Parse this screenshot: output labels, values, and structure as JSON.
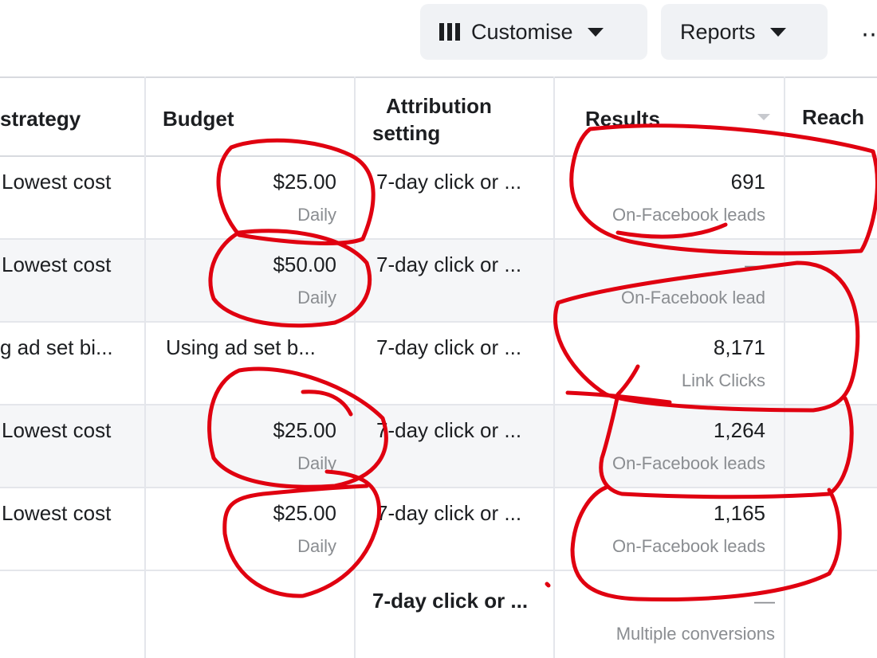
{
  "toolbar": {
    "customise_label": "Customise",
    "reports_label": "Reports",
    "more_label": "⋯"
  },
  "table": {
    "headers": {
      "strategy": "strategy",
      "budget": "Budget",
      "attribution_line1": "Attribution",
      "attribution_line2": "setting",
      "results": "Results",
      "reach": "Reach"
    },
    "rows": [
      {
        "strategy": "Lowest cost",
        "budget": "$25.00",
        "budget_type": "Daily",
        "attribution": "7-day click or ...",
        "result": "691",
        "result_type": "On-Facebook leads"
      },
      {
        "strategy": "Lowest cost",
        "budget": "$50.00",
        "budget_type": "Daily",
        "attribution": "7-day click or ...",
        "result": "—",
        "result_type": "On-Facebook lead"
      },
      {
        "strategy": "g ad set bi...",
        "budget": "Using ad set b...",
        "budget_type": "",
        "attribution": "7-day click or ...",
        "result": "8,171",
        "result_type": "Link Clicks"
      },
      {
        "strategy": "Lowest cost",
        "budget": "$25.00",
        "budget_type": "Daily",
        "attribution": "7-day click or ...",
        "result": "1,264",
        "result_type": "On-Facebook leads"
      },
      {
        "strategy": "Lowest cost",
        "budget": "$25.00",
        "budget_type": "Daily",
        "attribution": "7-day click or ...",
        "result": "1,165",
        "result_type": "On-Facebook leads"
      }
    ],
    "totals": {
      "attribution": "7-day click or ...",
      "result": "—",
      "result_type": "Multiple conversions"
    }
  },
  "colors": {
    "annotation": "#e00010",
    "button_bg": "#f0f2f5",
    "row_alt": "#f5f6f8"
  }
}
